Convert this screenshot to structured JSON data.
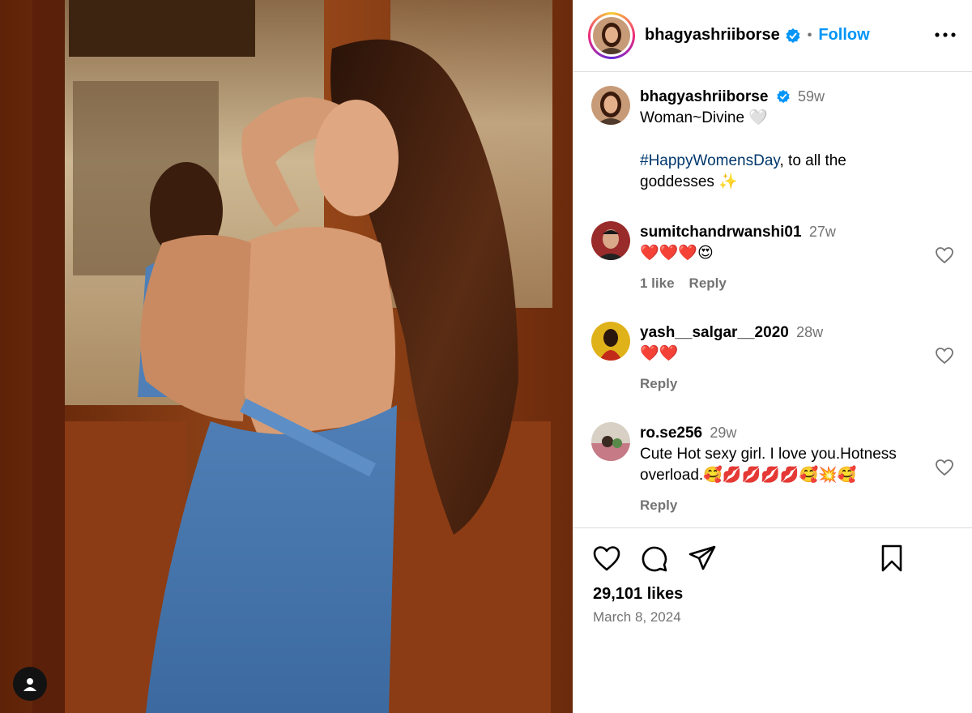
{
  "post": {
    "author": "bhagyashriiborse",
    "follow_label": "Follow",
    "separator": "•",
    "likes": "29,101 likes",
    "date": "March 8, 2024"
  },
  "caption": {
    "username": "bhagyashriiborse",
    "time": "59w",
    "line1": "Woman~Divine 🤍",
    "hashtag": "#HappyWomensDay",
    "line2_rest": ", to all the goddesses ✨"
  },
  "comments": [
    {
      "username": "sumitchandrwanshi01",
      "time": "27w",
      "text": "❤️❤️❤️😍",
      "likes": "1 like",
      "reply": "Reply"
    },
    {
      "username": "yash__salgar__2020",
      "time": "28w",
      "text": "❤️❤️",
      "likes": "",
      "reply": "Reply"
    },
    {
      "username": "ro.se256",
      "time": "29w",
      "text": "Cute Hot sexy girl. I love you.Hotness overload.🥰💋💋💋💋🥰💥🥰",
      "likes": "",
      "reply": "Reply"
    }
  ],
  "icons": {
    "header": [
      "verified-badge-icon",
      "more-options-icon"
    ],
    "actions": [
      "like-heart-icon",
      "comment-icon",
      "share-send-icon",
      "save-bookmark-icon"
    ],
    "photo": [
      "tagged-user-icon"
    ]
  },
  "colors": {
    "follow": "#0095f6",
    "hashtag": "#00376b",
    "secondary_text": "#737373",
    "verified": "#0095f6"
  }
}
